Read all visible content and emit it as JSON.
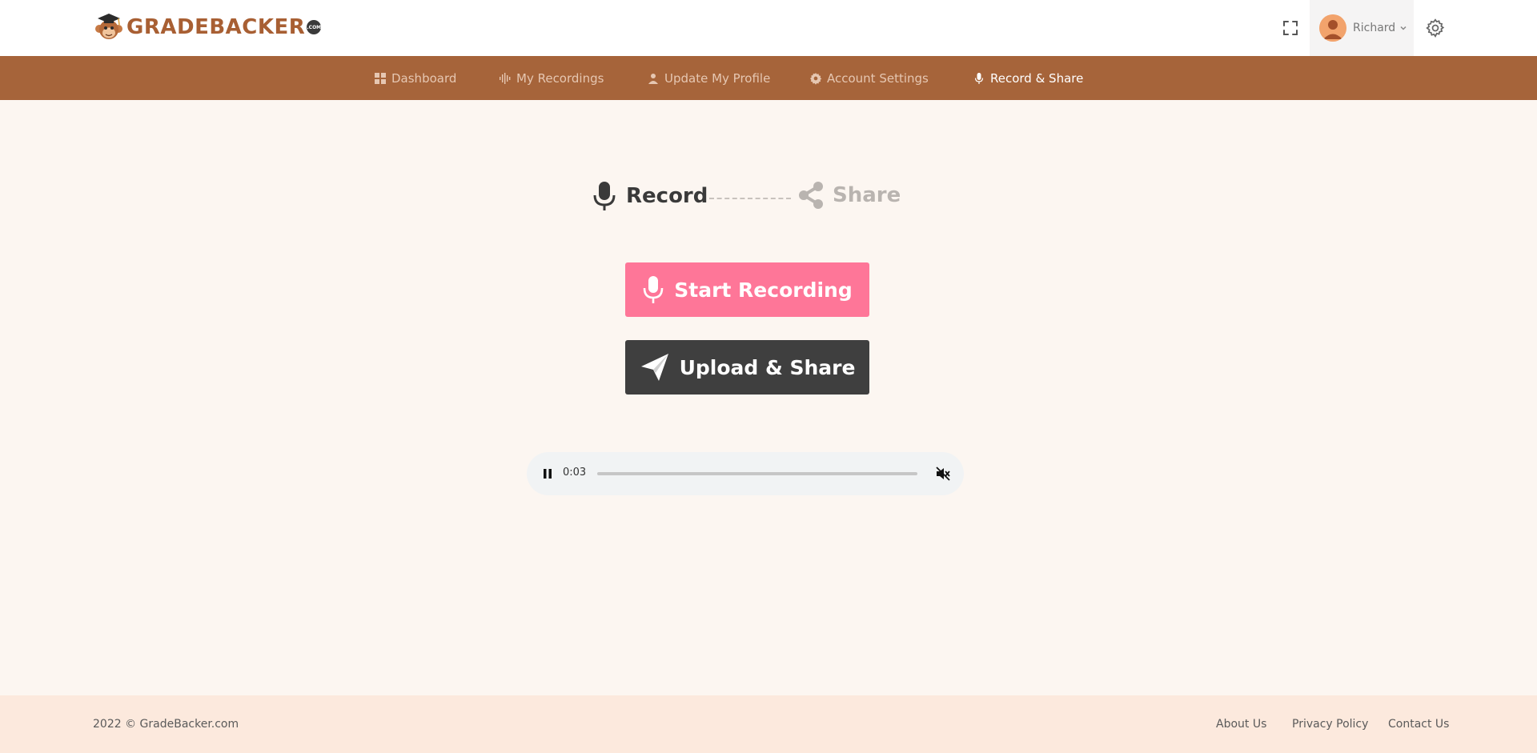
{
  "header": {
    "logo_text": "GRADEBACKER",
    "logo_suffix": ".COM",
    "user_name": "Richard",
    "icons": {
      "fullscreen": "fullscreen-icon",
      "chevron": "chevron-down-icon",
      "settings": "gear-icon"
    }
  },
  "nav": {
    "items": [
      {
        "label": "Dashboard",
        "icon": "dashboard-icon",
        "active": false
      },
      {
        "label": "My Recordings",
        "icon": "waveform-icon",
        "active": false
      },
      {
        "label": "Update My Profile",
        "icon": "profile-icon",
        "active": false
      },
      {
        "label": "Account Settings",
        "icon": "gear-icon",
        "active": false
      },
      {
        "label": "Record & Share",
        "icon": "microphone-icon",
        "active": true
      }
    ]
  },
  "steps": {
    "record_label": "Record",
    "share_label": "Share"
  },
  "buttons": {
    "start_recording": "Start Recording",
    "upload_share": "Upload & Share"
  },
  "audio": {
    "current_time": "0:03",
    "state": "playing",
    "muted": true
  },
  "footer": {
    "copyright": "2022 © GradeBacker.com",
    "links": [
      "About Us",
      "Privacy Policy",
      "Contact Us"
    ]
  },
  "colors": {
    "nav_bg": "#a6643a",
    "record_button": "#fe7698",
    "upload_button": "#3f3f3f",
    "page_bg": "#fcf6f1",
    "footer_bg": "#fce9dd"
  }
}
